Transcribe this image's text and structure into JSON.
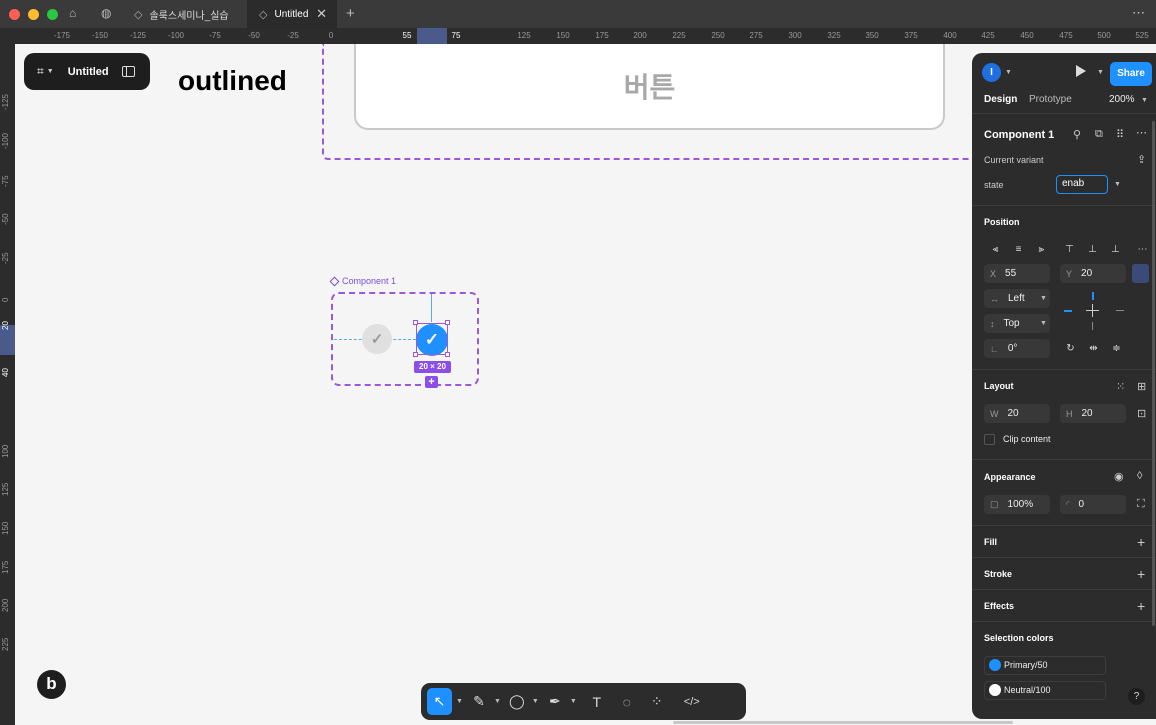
{
  "browser": {
    "tabs": [
      {
        "label": "솔룩스세미나_실습",
        "active": false
      },
      {
        "label": "Untitled",
        "active": true
      }
    ],
    "new_tab": "+",
    "more": "⋯"
  },
  "rulers": {
    "top": [
      "-175",
      "-150",
      "-125",
      "-100",
      "-75",
      "-50",
      "-25",
      "0",
      "55",
      "75",
      "125",
      "150",
      "175",
      "200",
      "225",
      "250",
      "275",
      "300",
      "325",
      "350",
      "375",
      "400",
      "425",
      "450",
      "475",
      "500",
      "525"
    ],
    "left": [
      "-125",
      "-100",
      "-75",
      "-50",
      "-25",
      "0",
      "20",
      "40",
      "100",
      "125",
      "150",
      "175",
      "200",
      "225"
    ]
  },
  "canvas": {
    "file_title": "Untitled",
    "heading": "outlined",
    "button_text": "버튼",
    "component_label": "Component 1",
    "size_label": "20 × 20",
    "add_label": "+",
    "user_initial": "b"
  },
  "bottom_toolbar": {
    "tools": [
      {
        "name": "move-tool",
        "icon": "↖",
        "active": true,
        "caret": true
      },
      {
        "name": "pencil-tool",
        "icon": "✎",
        "active": false,
        "caret": true
      },
      {
        "name": "ellipse-tool",
        "icon": "◯",
        "active": false,
        "caret": true
      },
      {
        "name": "pen-tool",
        "icon": "✒",
        "active": false,
        "caret": true
      },
      {
        "name": "text-tool",
        "icon": "T",
        "active": false,
        "caret": false
      },
      {
        "name": "comment-tool",
        "icon": "◌",
        "active": false,
        "caret": false
      },
      {
        "name": "components-tool",
        "icon": "⁘",
        "active": false,
        "caret": false
      },
      {
        "name": "dev-mode-tool",
        "icon": "</>",
        "active": false,
        "caret": false
      }
    ]
  },
  "panel": {
    "user_initial": "I",
    "share": "Share",
    "tabs": {
      "design": "Design",
      "prototype": "Prototype"
    },
    "zoom": "200%",
    "component_name": "Component 1",
    "current_variant": "Current variant",
    "property_name": "state",
    "property_value": "enab",
    "position": {
      "title": "Position",
      "x_label": "X",
      "x": "55",
      "y_label": "Y",
      "y": "20",
      "horizontal_constraint": "Left",
      "vertical_constraint": "Top",
      "rotation": "0°"
    },
    "layout": {
      "title": "Layout",
      "w_label": "W",
      "w": "20",
      "h_label": "H",
      "h": "20",
      "clip_content": "Clip content"
    },
    "appearance": {
      "title": "Appearance",
      "opacity": "100%",
      "corner_radius": "0"
    },
    "fill": "Fill",
    "stroke": "Stroke",
    "effects": "Effects",
    "selection_colors": {
      "title": "Selection colors",
      "colors": [
        {
          "name": "Primary/50",
          "hex": "#1e90ff"
        },
        {
          "name": "Neutral/100",
          "hex": "#ffffff"
        }
      ]
    },
    "help": "?"
  },
  "colors": {
    "accent": "#1e90ff",
    "component_purple": "#9b59d8",
    "panel_bg": "#2c2c2c"
  }
}
